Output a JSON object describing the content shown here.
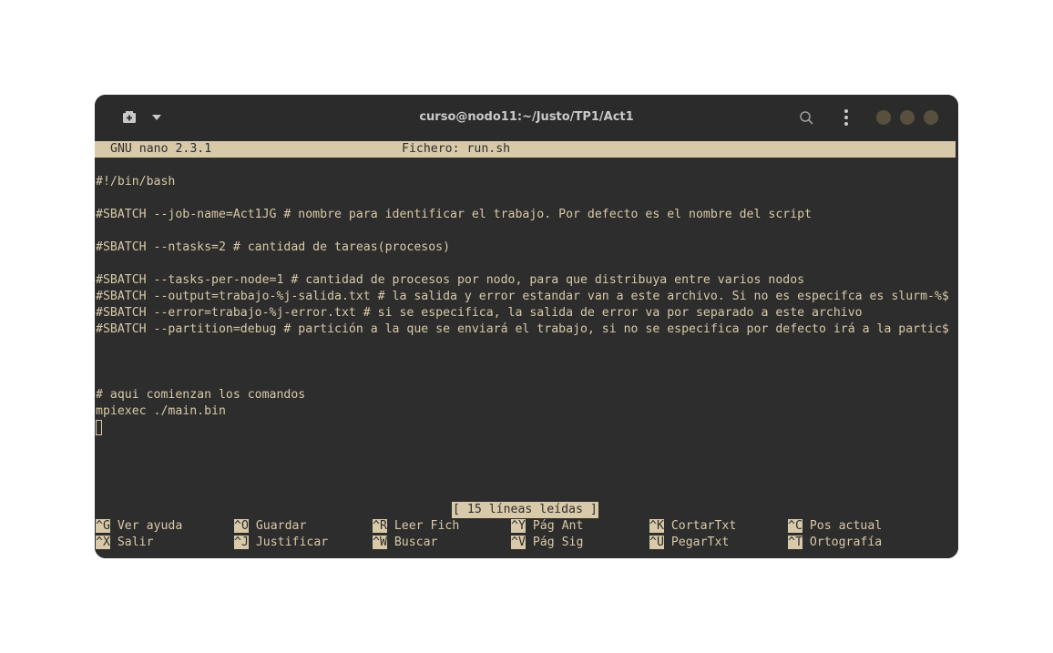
{
  "titlebar": {
    "title": "curso@nodo11:~/Justo/TP1/Act1",
    "icons": [
      "new-tab-icon",
      "chevron-down-icon",
      "search-icon",
      "kebab-menu-icon"
    ],
    "window_button_color": "#57503f"
  },
  "colors": {
    "terminal_bg": "#2d2d2d",
    "terminal_fg": "#d8c9a8"
  },
  "nano": {
    "version": "GNU nano 2.3.1",
    "file_label": "Fichero: run.sh",
    "lines": [
      "#!/bin/bash",
      "",
      "#SBATCH --job-name=Act1JG # nombre para identificar el trabajo. Por defecto es el nombre del script",
      "",
      "#SBATCH --ntasks=2 # cantidad de tareas(procesos)",
      "",
      "#SBATCH --tasks-per-node=1 # cantidad de procesos por nodo, para que distribuya entre varios nodos",
      "#SBATCH --output=trabajo-%j-salida.txt # la salida y error estandar van a este archivo. Si no es especifca es slurm-%$",
      "#SBATCH --error=trabajo-%j-error.txt # si se especifica, la salida de error va por separado a este archivo",
      "#SBATCH --partition=debug # partición a la que se enviará el trabajo, si no se especifica por defecto irá a la partic$",
      "",
      "",
      "",
      "# aqui comienzan los comandos",
      "mpiexec ./main.bin"
    ],
    "status": "[ 15 líneas leídas ]",
    "shortcuts": [
      {
        "key": "^G",
        "label": "Ver ayuda"
      },
      {
        "key": "^O",
        "label": "Guardar"
      },
      {
        "key": "^R",
        "label": "Leer Fich"
      },
      {
        "key": "^Y",
        "label": "Pág Ant"
      },
      {
        "key": "^K",
        "label": "CortarTxt"
      },
      {
        "key": "^C",
        "label": "Pos actual"
      },
      {
        "key": "^X",
        "label": "Salir"
      },
      {
        "key": "^J",
        "label": "Justificar"
      },
      {
        "key": "^W",
        "label": "Buscar"
      },
      {
        "key": "^V",
        "label": "Pág Sig"
      },
      {
        "key": "^U",
        "label": "PegarTxt"
      },
      {
        "key": "^T",
        "label": "Ortografía"
      }
    ]
  }
}
